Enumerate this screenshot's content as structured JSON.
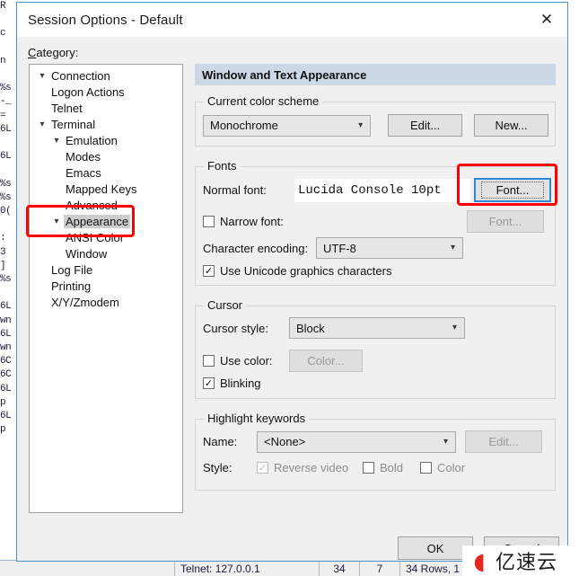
{
  "background": {
    "terminal_text": "R\n\nc\n\nn\n\n%s\n-_\n=\n6L\n\n6L\n\n%s\n%s\n0(\n\n:\n3\n]\n%s\n\n6L\nwn\n6L\nwn\n6C\n6C\n6L\np\n6L\np",
    "statusbar": {
      "connection": "Telnet: 127.0.0.1",
      "col": "34",
      "row": "7",
      "size": "34 Rows, 1"
    }
  },
  "dialog": {
    "title": "Session Options - Default",
    "close_icon": "close-icon",
    "category_label": "Category:",
    "tree": [
      {
        "label": "Connection",
        "depth": 0,
        "chevron": "v",
        "selected": false
      },
      {
        "label": "Logon Actions",
        "depth": 1,
        "chevron": "",
        "selected": false
      },
      {
        "label": "Telnet",
        "depth": 1,
        "chevron": "",
        "selected": false
      },
      {
        "label": "Terminal",
        "depth": 0,
        "chevron": "v",
        "selected": false
      },
      {
        "label": "Emulation",
        "depth": 1,
        "chevron": "v",
        "selected": false
      },
      {
        "label": "Modes",
        "depth": 2,
        "chevron": "",
        "selected": false
      },
      {
        "label": "Emacs",
        "depth": 2,
        "chevron": "",
        "selected": false
      },
      {
        "label": "Mapped Keys",
        "depth": 2,
        "chevron": "",
        "selected": false
      },
      {
        "label": "Advanced",
        "depth": 2,
        "chevron": "",
        "selected": false
      },
      {
        "label": "Appearance",
        "depth": 1,
        "chevron": "v",
        "selected": true
      },
      {
        "label": "ANSI Color",
        "depth": 2,
        "chevron": "",
        "selected": false
      },
      {
        "label": "Window",
        "depth": 2,
        "chevron": "",
        "selected": false
      },
      {
        "label": "Log File",
        "depth": 1,
        "chevron": "",
        "selected": false
      },
      {
        "label": "Printing",
        "depth": 1,
        "chevron": "",
        "selected": false
      },
      {
        "label": "X/Y/Zmodem",
        "depth": 1,
        "chevron": "",
        "selected": false
      }
    ],
    "panel": {
      "header": "Window and Text Appearance",
      "color_scheme": {
        "group_title": "Current color scheme",
        "value": "Monochrome",
        "edit_button": "Edit...",
        "new_button": "New..."
      },
      "fonts": {
        "group_title": "Fonts",
        "normal_font_label": "Normal font:",
        "normal_font_value": "Lucida Console 10pt",
        "normal_font_button": "Font...",
        "narrow_font_label": "Narrow font:",
        "narrow_font_checked": false,
        "narrow_font_button": "Font...",
        "encoding_label": "Character encoding:",
        "encoding_value": "UTF-8",
        "unicode_label": "Use Unicode graphics characters",
        "unicode_checked": true
      },
      "cursor": {
        "group_title": "Cursor",
        "style_label": "Cursor style:",
        "style_value": "Block",
        "use_color_label": "Use color:",
        "use_color_checked": false,
        "color_button": "Color...",
        "blinking_label": "Blinking",
        "blinking_checked": true
      },
      "highlight": {
        "group_title": "Highlight keywords",
        "name_label": "Name:",
        "name_value": "<None>",
        "edit_button": "Edit...",
        "style_label": "Style:",
        "reverse_video_label": "Reverse video",
        "reverse_video_checked": true,
        "bold_label": "Bold",
        "bold_checked": false,
        "color_label": "Color",
        "color_checked": false
      }
    },
    "ok_button": "OK",
    "cancel_button": "Cancel"
  },
  "watermark": {
    "mark": "@",
    "text": "亿速云"
  },
  "colors": {
    "accent": "#2f86d6",
    "annotation": "#ff0000",
    "panel_header": "#ccd8e6",
    "dialog_bg": "#f0f0f0"
  }
}
